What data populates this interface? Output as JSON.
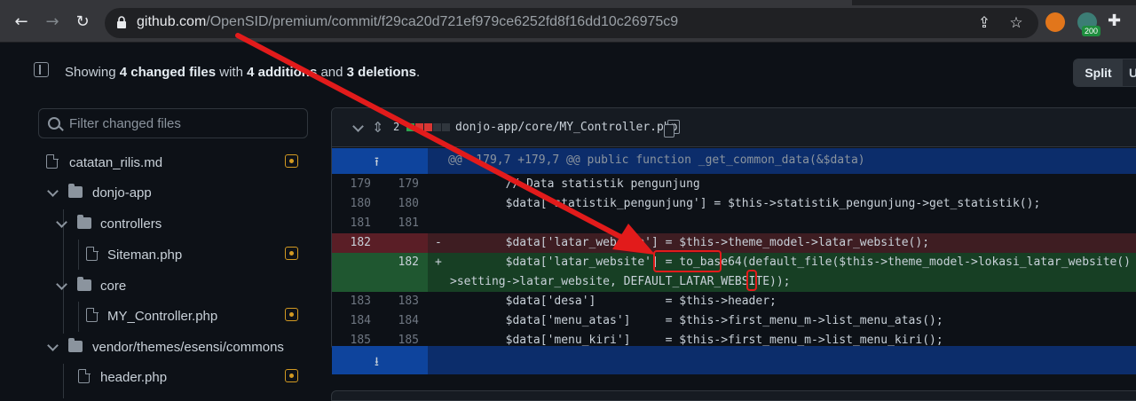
{
  "browser": {
    "url_host": "github.com",
    "url_path": "/OpenSID/premium/commit/f29ca20d721ef979ce6252fd8f16dd10c26975c9",
    "extension_badge": "200",
    "icons": [
      "back-icon",
      "forward-icon",
      "reload-icon",
      "lock-icon",
      "share-icon",
      "star-icon",
      "metamask-icon",
      "extension-icon",
      "puzzle-icon"
    ]
  },
  "summary": {
    "prefix": "Showing ",
    "files": "4 changed files",
    "middle": " with ",
    "additions": "4 additions",
    "and": " and ",
    "deletions": "3 deletions",
    "suffix": "."
  },
  "view_toggle": {
    "split": "Split",
    "unified": "U"
  },
  "filter": {
    "placeholder": "Filter changed files"
  },
  "tree": [
    {
      "label": "catatan_rilis.md",
      "type": "file"
    },
    {
      "label": "donjo-app",
      "type": "folder"
    },
    {
      "label": "controllers",
      "type": "folder"
    },
    {
      "label": "Siteman.php",
      "type": "file"
    },
    {
      "label": "core",
      "type": "folder"
    },
    {
      "label": "MY_Controller.php",
      "type": "file"
    },
    {
      "label": "vendor/themes/esensi/commons",
      "type": "folder"
    },
    {
      "label": "header.php",
      "type": "file"
    }
  ],
  "diff": {
    "changes": "2",
    "path": "donjo-app/core/MY_Controller.php",
    "hunk": "@@ -179,7 +179,7 @@ public function _get_common_data(&$data)",
    "lines": [
      {
        "old": "179",
        "new": "179",
        "sign": "",
        "code": "        // Data statistik pengunjung"
      },
      {
        "old": "180",
        "new": "180",
        "sign": "",
        "code": "        $data['statistik_pengunjung'] = $this->statistik_pengunjung->get_statistik();"
      },
      {
        "old": "181",
        "new": "181",
        "sign": "",
        "code": ""
      },
      {
        "old": "182",
        "new": "",
        "sign": "-",
        "code": "        $data['latar_website'] = $this->theme_model->latar_website();"
      },
      {
        "old": "",
        "new": "182",
        "sign": "+",
        "code": "        $data['latar_website'] = to_base64(default_file($this->theme_model->lokasi_latar_website() . $this-",
        "code2": ">setting->latar_website, DEFAULT_LATAR_WEBSITE));"
      },
      {
        "old": "183",
        "new": "183",
        "sign": "",
        "code": "        $data['desa']          = $this->header;"
      },
      {
        "old": "184",
        "new": "184",
        "sign": "",
        "code": "        $data['menu_atas']     = $this->first_menu_m->list_menu_atas();"
      },
      {
        "old": "185",
        "new": "185",
        "sign": "",
        "code": "        $data['menu_kiri']     = $this->first_menu_m->list_menu_kiri();"
      }
    ],
    "highlight_colors": {
      "annotation": "#e21b1b",
      "added": "#2da44e",
      "deleted": "#cf222e"
    }
  }
}
